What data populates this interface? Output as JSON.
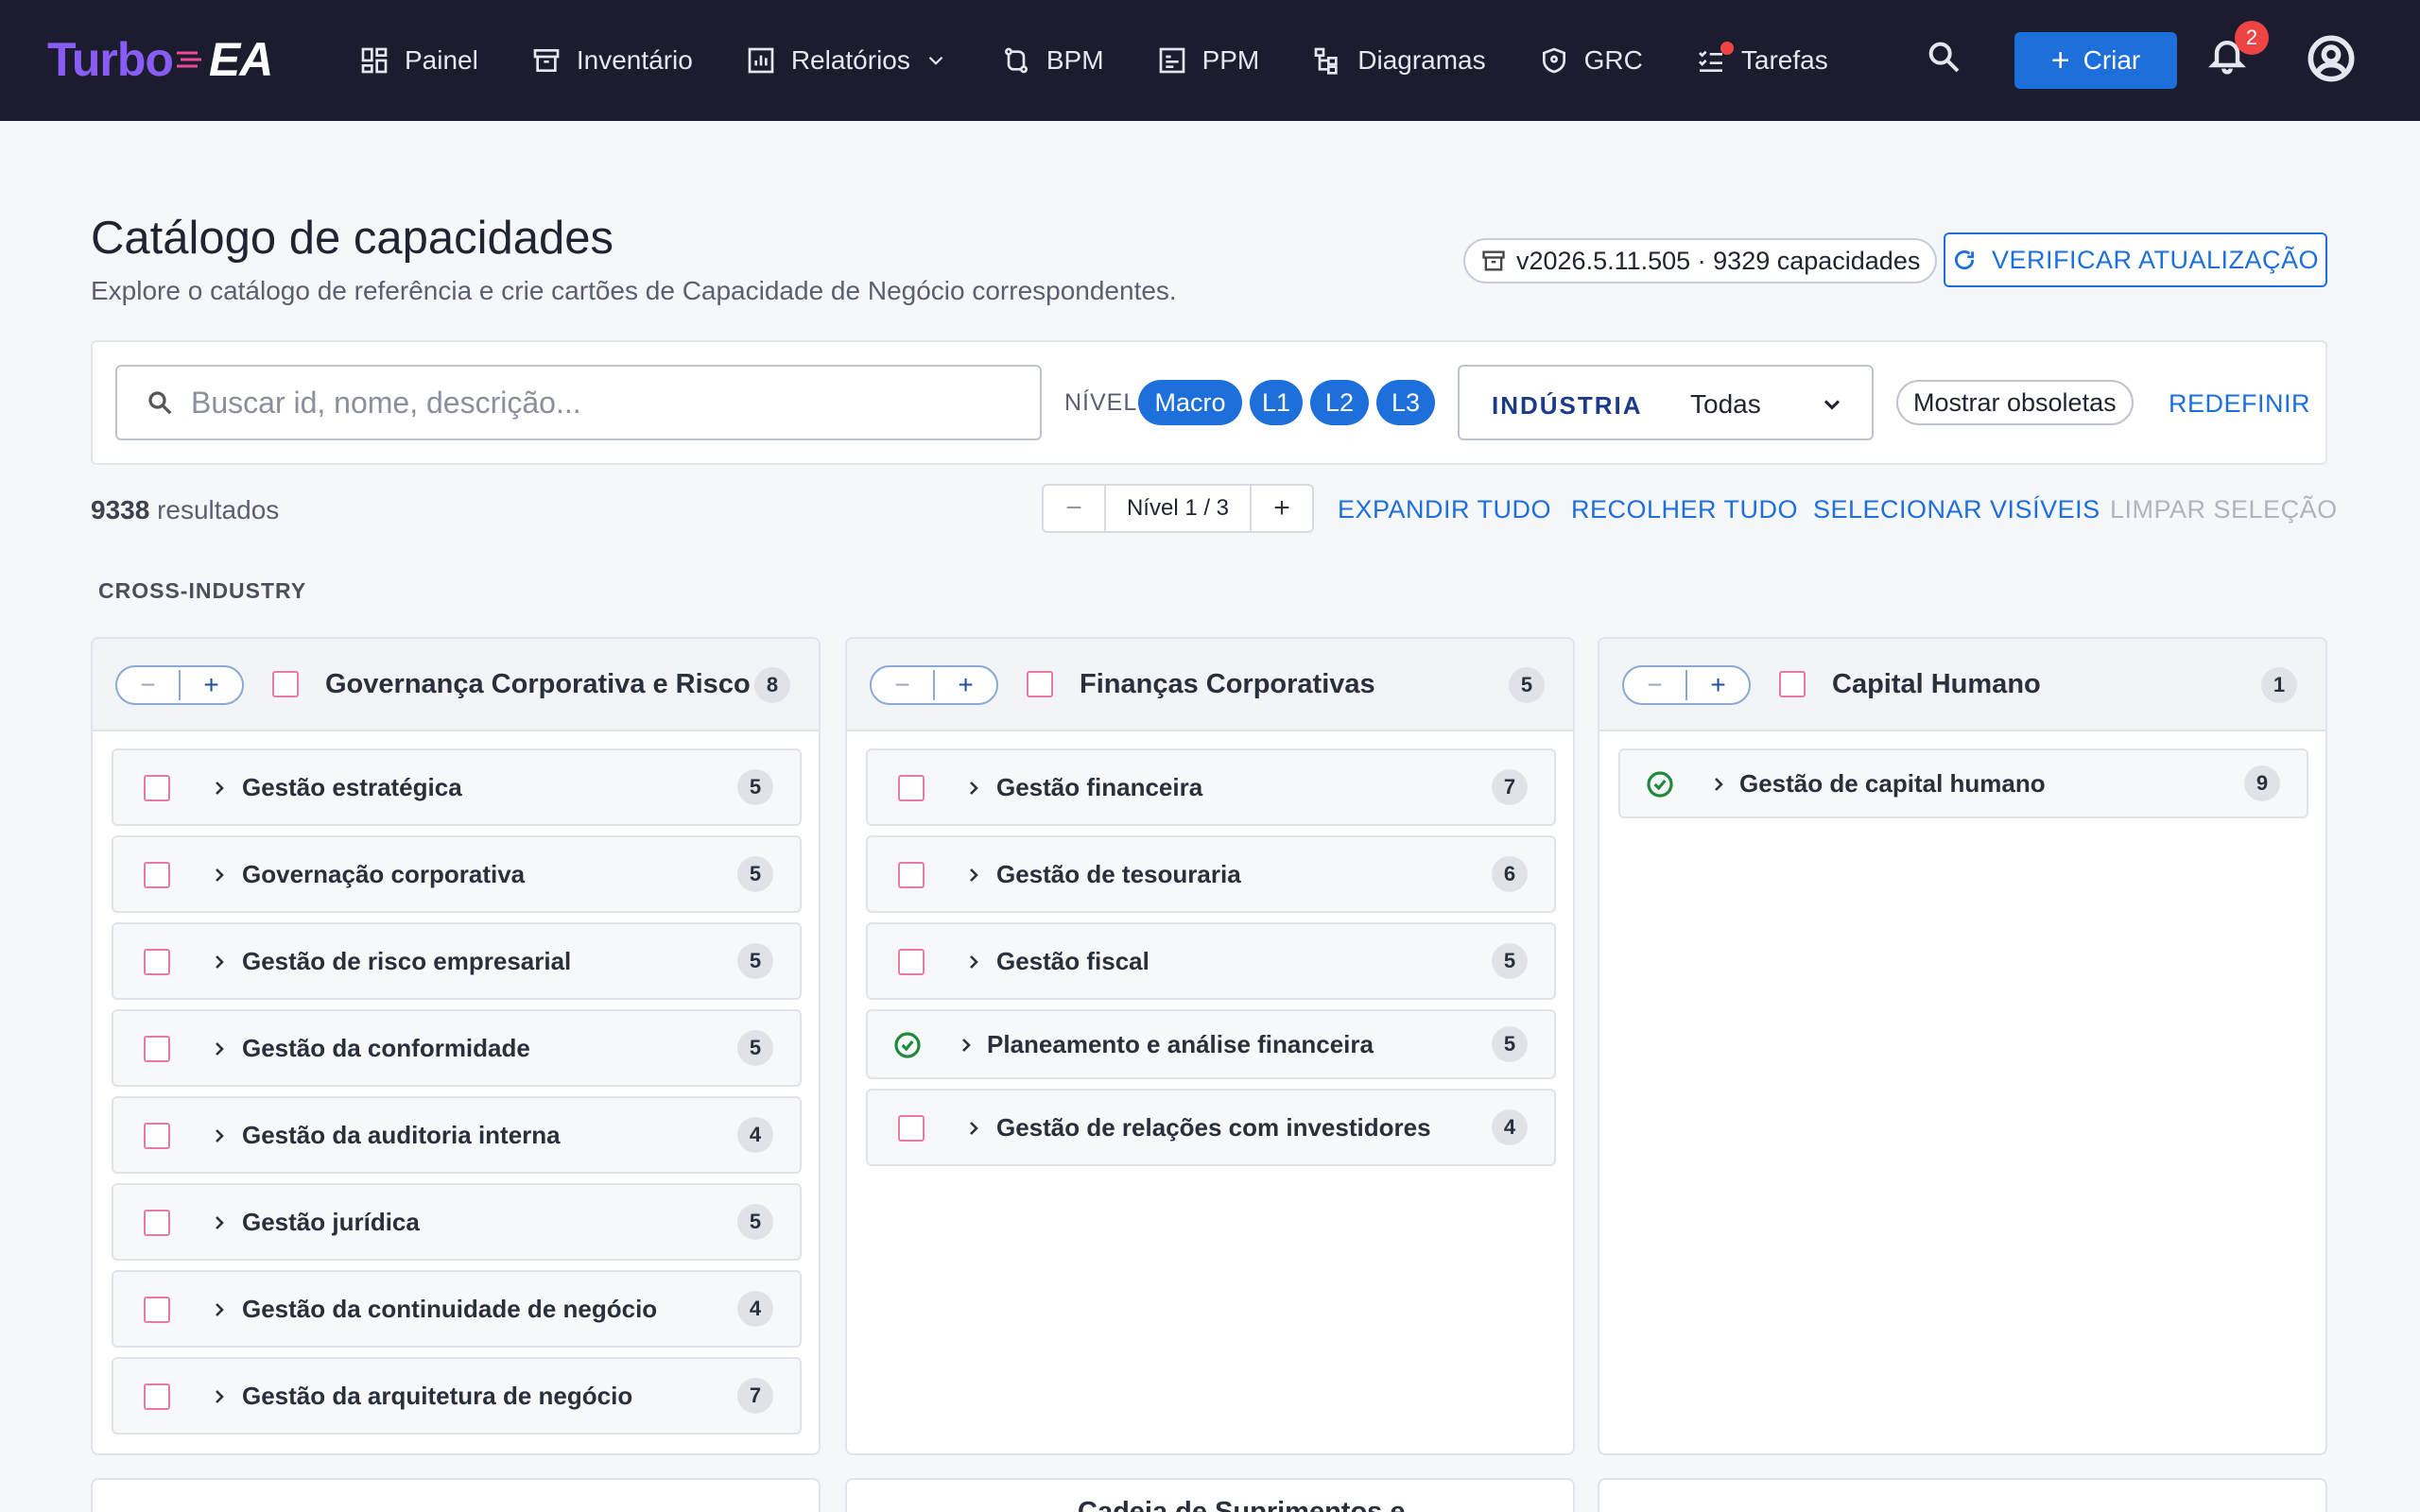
{
  "app": {
    "logo": {
      "part1": "Turbo",
      "part2": "EA"
    },
    "nav": [
      {
        "label": "Painel",
        "icon": "dashboard-icon"
      },
      {
        "label": "Inventário",
        "icon": "archive-icon"
      },
      {
        "label": "Relatórios",
        "icon": "bar-chart-icon",
        "has_dropdown": true
      },
      {
        "label": "BPM",
        "icon": "route-icon"
      },
      {
        "label": "PPM",
        "icon": "project-icon"
      },
      {
        "label": "Diagramas",
        "icon": "diagram-icon"
      },
      {
        "label": "GRC",
        "icon": "shield-icon"
      },
      {
        "label": "Tarefas",
        "icon": "tasks-icon",
        "has_dot": true
      }
    ],
    "create_label": "Criar",
    "notifications_count": "2",
    "accent": "#1d6fdc"
  },
  "page": {
    "title": "Catálogo de capacidades",
    "subtitle": "Explore o catálogo de referência e crie cartões de Capacidade de Negócio correspondentes.",
    "version": "v2026.5.11.505 · 9329 capacidades",
    "check_update": "VERIFICAR ATUALIZAÇÃO"
  },
  "filters": {
    "search_placeholder": "Buscar id, nome, descrição...",
    "search_value": "",
    "level_label": "NÍVEL",
    "levels": [
      "Macro",
      "L1",
      "L2",
      "L3"
    ],
    "industry_label": "INDÚSTRIA",
    "industry_value": "Todas",
    "show_obsolete": "Mostrar obsoletas",
    "reset": "REDEFINIR"
  },
  "results": {
    "count": "9338",
    "count_suffix": " resultados",
    "level_indicator": "Nível 1 / 3",
    "expand_all": "EXPANDIR TUDO",
    "collapse_all": "RECOLHER TUDO",
    "select_visible": "SELECIONAR VISÍVEIS",
    "clear_selection": "LIMPAR SELEÇÃO"
  },
  "group": {
    "label": "CROSS-INDUSTRY",
    "columns": [
      {
        "title": "Governança Corporativa e Risco",
        "count": "8",
        "items": [
          {
            "label": "Gestão estratégica",
            "count": "5",
            "existing": false
          },
          {
            "label": "Governação corporativa",
            "count": "5",
            "existing": false
          },
          {
            "label": "Gestão de risco empresarial",
            "count": "5",
            "existing": false
          },
          {
            "label": "Gestão da conformidade",
            "count": "5",
            "existing": false
          },
          {
            "label": "Gestão da auditoria interna",
            "count": "4",
            "existing": false
          },
          {
            "label": "Gestão jurídica",
            "count": "5",
            "existing": false
          },
          {
            "label": "Gestão da continuidade de negócio",
            "count": "4",
            "existing": false
          },
          {
            "label": "Gestão da arquitetura de negócio",
            "count": "7",
            "existing": false
          }
        ]
      },
      {
        "title": "Finanças Corporativas",
        "count": "5",
        "items": [
          {
            "label": "Gestão financeira",
            "count": "7",
            "existing": false
          },
          {
            "label": "Gestão de tesouraria",
            "count": "6",
            "existing": false
          },
          {
            "label": "Gestão fiscal",
            "count": "5",
            "existing": false
          },
          {
            "label": "Planeamento e análise financeira",
            "count": "5",
            "existing": true
          },
          {
            "label": "Gestão de relações com investidores",
            "count": "4",
            "existing": false
          }
        ]
      },
      {
        "title": "Capital Humano",
        "count": "1",
        "items": [
          {
            "label": "Gestão de capital humano",
            "count": "9",
            "existing": true
          }
        ]
      }
    ],
    "next_row_partial_title": "Cadeia de Suprimentos e"
  }
}
